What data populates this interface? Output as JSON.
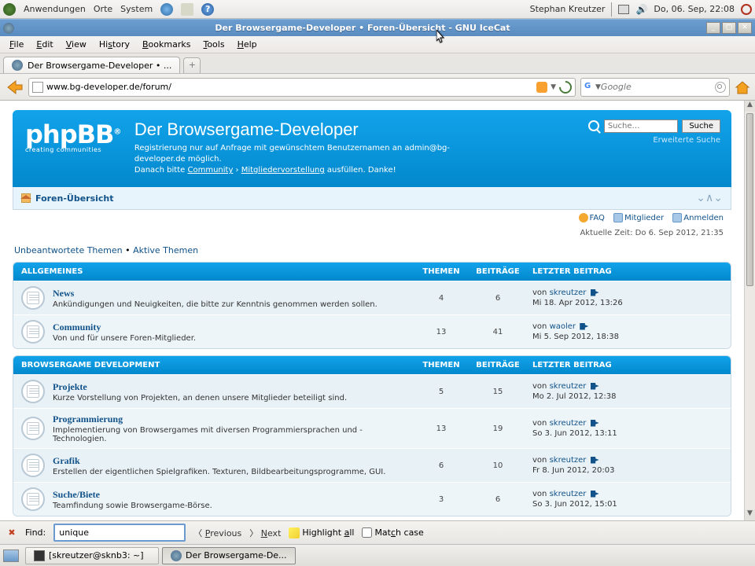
{
  "gnome": {
    "apps": "Anwendungen",
    "places": "Orte",
    "system": "System",
    "username": "Stephan Kreutzer",
    "datetime": "Do, 06. Sep, 22:08"
  },
  "window": {
    "title": "Der Browsergame-Developer • Foren-Übersicht - GNU IceCat"
  },
  "menubar": {
    "file": "File",
    "edit": "Edit",
    "view": "View",
    "history": "History",
    "bookmarks": "Bookmarks",
    "tools": "Tools",
    "help": "Help"
  },
  "tab": {
    "label": "Der Browsergame-Developer • ..."
  },
  "toolbar": {
    "url": "www.bg-developer.de/forum/",
    "search_placeholder": "Google"
  },
  "forum": {
    "logo": "phpBB",
    "logo_tag": "creating    communities",
    "reg_mark": "®",
    "title": "Der Browsergame-Developer",
    "desc1": "Registrierung nur auf Anfrage mit gewünschtem Benutzernamen an admin@bg-developer.de möglich.",
    "desc2_a": "Danach bitte ",
    "desc2_b": "Community",
    "desc2_c": " › ",
    "desc2_d": "Mitgliedervorstellung",
    "desc2_e": " ausfüllen. Danke!",
    "search_placeholder": "Suche…",
    "search_btn": "Suche",
    "advanced": "Erweiterte Suche",
    "breadcrumb": "Foren-Übersicht",
    "faq": "FAQ",
    "members": "Mitglieder",
    "login": "Anmelden",
    "current_time": "Aktuelle Zeit: Do 6. Sep 2012, 21:35",
    "unanswered": "Unbeantwortete Themen",
    "bullet": " • ",
    "active": "Aktive Themen",
    "col_topics": "Themen",
    "col_posts": "Beiträge",
    "col_last": "Letzter Beitrag",
    "by": "von ",
    "categories": [
      {
        "name": "Allgemeines",
        "forums": [
          {
            "title": "News",
            "desc": "Ankündigungen und Neuigkeiten, die bitte zur Kenntnis genommen werden sollen.",
            "topics": "4",
            "posts": "6",
            "last_user": "skreutzer",
            "last_time": "Mi 18. Apr 2012, 13:26"
          },
          {
            "title": "Community",
            "desc": "Von und für unsere Foren-Mitglieder.",
            "topics": "13",
            "posts": "41",
            "last_user": "waoler",
            "last_time": "Mi 5. Sep 2012, 18:38"
          }
        ]
      },
      {
        "name": "Browsergame Development",
        "forums": [
          {
            "title": "Projekte",
            "desc": "Kurze Vorstellung von Projekten, an denen unsere Mitglieder beteiligt sind.",
            "topics": "5",
            "posts": "15",
            "last_user": "skreutzer",
            "last_time": "Mo 2. Jul 2012, 12:38"
          },
          {
            "title": "Programmierung",
            "desc": "Implementierung von Browsergames mit diversen Programmiersprachen und -Technologien.",
            "topics": "13",
            "posts": "19",
            "last_user": "skreutzer",
            "last_time": "So 3. Jun 2012, 13:11"
          },
          {
            "title": "Grafik",
            "desc": "Erstellen der eigentlichen Spielgrafiken. Texturen, Bildbearbeitungsprogramme, GUI.",
            "topics": "6",
            "posts": "10",
            "last_user": "skreutzer",
            "last_time": "Fr 8. Jun 2012, 20:03"
          },
          {
            "title": "Suche/Biete",
            "desc": "Teamfindung sowie Browsergame-Börse.",
            "topics": "3",
            "posts": "6",
            "last_user": "skreutzer",
            "last_time": "So 3. Jun 2012, 15:01"
          }
        ]
      }
    ]
  },
  "findbar": {
    "label": "Find:",
    "value": "unique",
    "prev": "Previous",
    "next": "Next",
    "highlight": "Highlight all",
    "matchcase": "Match case"
  },
  "taskbar": {
    "term": "[skreutzer@sknb3: ~]",
    "browser": "Der Browsergame-De..."
  }
}
